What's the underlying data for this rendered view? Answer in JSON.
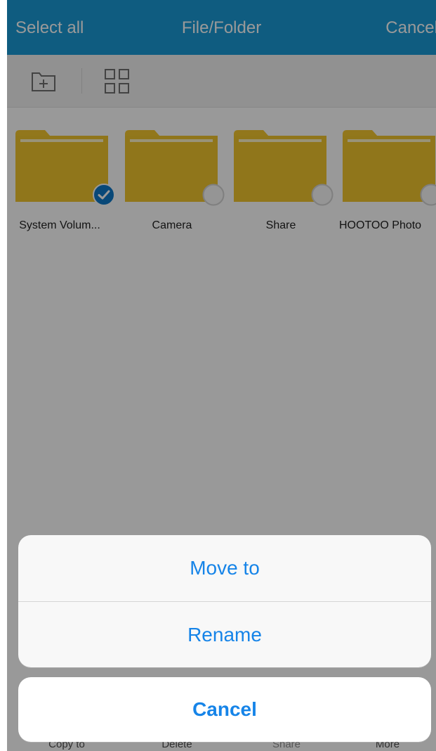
{
  "header": {
    "left_action": "Select all",
    "title": "File/Folder",
    "right_action": "Cancel"
  },
  "toolbar": {
    "new_folder_icon": "new-folder-icon",
    "grid_icon": "grid-view-icon"
  },
  "files": [
    {
      "name": "System Volum...",
      "selected": true
    },
    {
      "name": "Camera",
      "selected": false
    },
    {
      "name": "Share",
      "selected": false
    },
    {
      "name": "HOOTOO Photo",
      "selected": false
    }
  ],
  "action_sheet": {
    "options": [
      {
        "label": "Move to"
      },
      {
        "label": "Rename"
      }
    ],
    "cancel": "Cancel"
  },
  "bottom_bar": {
    "items": [
      {
        "label": "Copy to"
      },
      {
        "label": "Delete"
      },
      {
        "label": "Share"
      },
      {
        "label": "More"
      }
    ]
  },
  "colors": {
    "accent": "#1a9ad6",
    "action_text": "#1684e8",
    "folder": "#f3c72f",
    "overlay": "#000000"
  }
}
